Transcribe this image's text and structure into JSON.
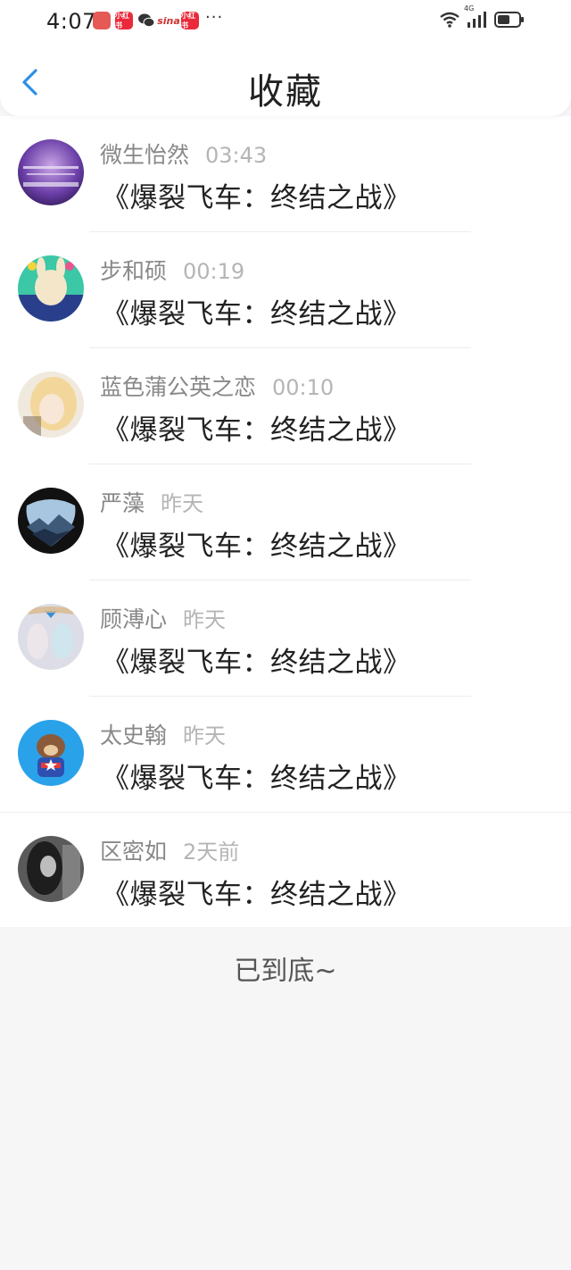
{
  "status_bar": {
    "time": "4:07",
    "notif_icons": [
      "app-notification-icon",
      "xiaohongshu-icon",
      "wechat-icon",
      "weibo-icon",
      "xiaohongshu-icon"
    ],
    "notif_labels": [
      "",
      "小红书",
      "",
      "sina",
      "小红书"
    ],
    "overflow": "···",
    "network": "4G",
    "right_icons": [
      "wifi-icon",
      "signal-icon",
      "battery-icon"
    ]
  },
  "header": {
    "title": "收藏",
    "back_icon": "chevron-left-icon",
    "accent_color": "#2e8fe6"
  },
  "items": [
    {
      "name": "微生怡然",
      "time": "03:43",
      "subject": "《爆裂飞车：终结之战》"
    },
    {
      "name": "步和硕",
      "time": "00:19",
      "subject": "《爆裂飞车：终结之战》"
    },
    {
      "name": "蓝色蒲公英之恋",
      "time": "00:10",
      "subject": "《爆裂飞车：终结之战》"
    },
    {
      "name": "严藻",
      "time": "昨天",
      "subject": "《爆裂飞车：终结之战》"
    },
    {
      "name": "顾溥心",
      "time": "昨天",
      "subject": "《爆裂飞车：终结之战》"
    },
    {
      "name": "太史翰",
      "time": "昨天",
      "subject": "《爆裂飞车：终结之战》"
    },
    {
      "name": "区密如",
      "time": "2天前",
      "subject": "《爆裂飞车：终结之战》"
    }
  ],
  "footer": {
    "end_text": "已到底~"
  }
}
